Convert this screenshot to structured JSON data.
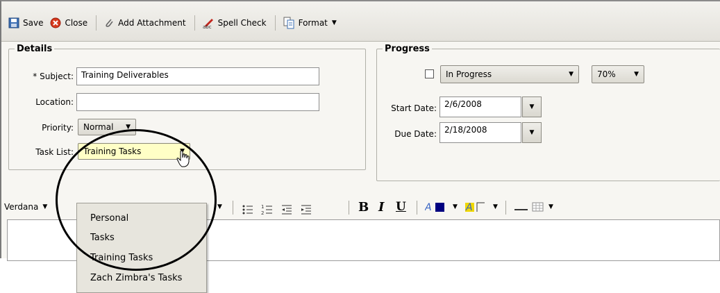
{
  "toolbar": {
    "save_label": "Save",
    "close_label": "Close",
    "attach_label": "Add Attachment",
    "spell_label": "Spell Check",
    "format_label": "Format"
  },
  "details": {
    "legend": "Details",
    "subject_label": "* Subject:",
    "subject_value": "Training Deliverables",
    "location_label": "Location:",
    "location_value": "",
    "priority_label": "Priority:",
    "priority_value": "Normal",
    "tasklist_label": "Task List:",
    "tasklist_value": "Training Tasks"
  },
  "progress": {
    "legend": "Progress",
    "status_value": "In Progress",
    "percent_value": "70%",
    "start_label": "Start Date:",
    "start_value": "2/6/2008",
    "due_label": "Due Date:",
    "due_value": "2/18/2008"
  },
  "tasklist_dropdown": {
    "options": [
      "Personal",
      "Tasks",
      "Training Tasks",
      "Zach Zimbra's Tasks"
    ]
  },
  "editor_toolbar": {
    "font_value": "Verdana",
    "bold": "B",
    "italic": "I",
    "underline": "U"
  },
  "colors": {
    "highlight_field": "#ffffc6",
    "text_color_swatch": "#000080",
    "circle": "#000000"
  }
}
